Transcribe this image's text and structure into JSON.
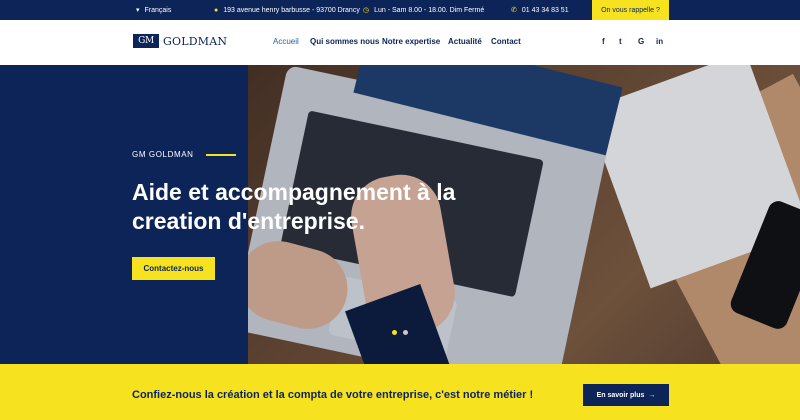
{
  "topbar": {
    "language": "Français",
    "language_icon": "chevron-down-icon",
    "address": "193 avenue henry barbusse - 93700 Drancy",
    "address_icon": "map-marker-icon",
    "hours": "Lun - Sam 8.00 - 18.00. Dim Fermé",
    "hours_icon": "clock-icon",
    "phone": "01 43 34 83 51",
    "phone_icon": "phone-icon",
    "callback": "On vous rappelle ?"
  },
  "header": {
    "logo_mark": "GM",
    "logo_text": "GOLDMAN",
    "nav": [
      "Accueil",
      "Qui sommes nous",
      "Notre expertise",
      "Actualité",
      "Contact"
    ],
    "social": [
      "f",
      "t",
      "G",
      "in"
    ]
  },
  "hero": {
    "eyebrow": "GM GOLDMAN",
    "title": "Aide et accompagnement à la creation d'entreprise.",
    "cta": "Contactez-nous",
    "slides_total": 2,
    "slide_active": 1
  },
  "band": {
    "text": "Confiez-nous la création et la compta de votre entreprise, c'est notre métier !",
    "button": "En savoir plus",
    "button_arrow": "→"
  },
  "colors": {
    "navy": "#0c2458",
    "yellow": "#f6e21f",
    "nav_active": "#1d5fb0"
  }
}
